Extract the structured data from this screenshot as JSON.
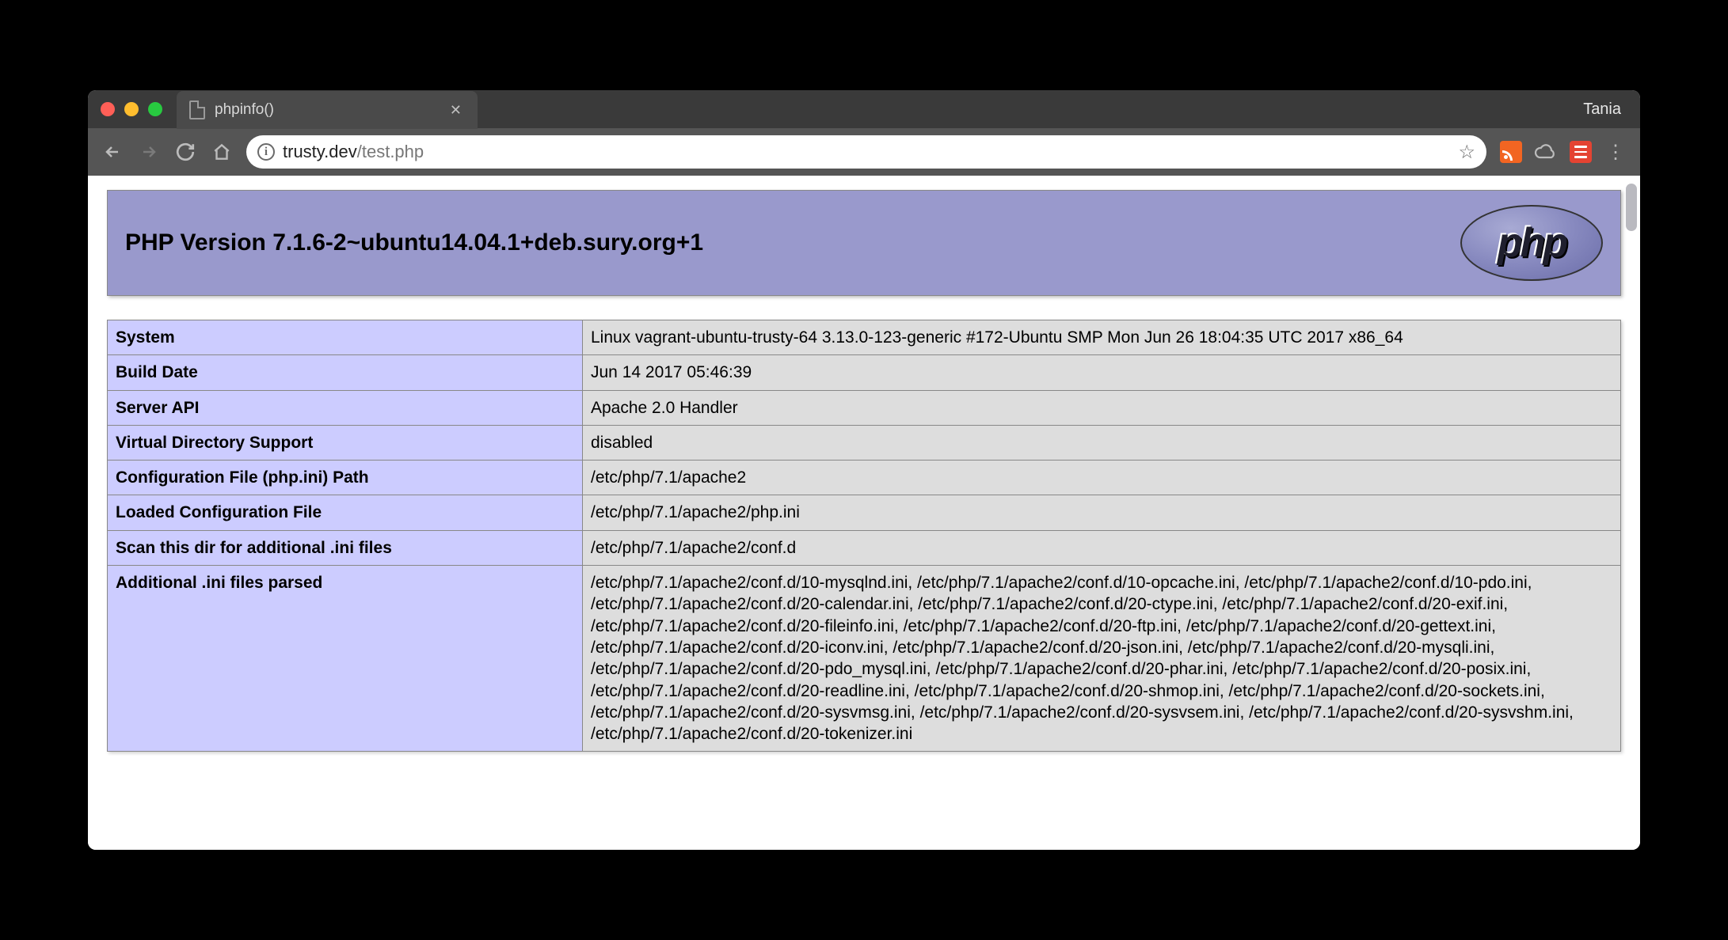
{
  "window": {
    "tab_title": "phpinfo()",
    "profile_name": "Tania"
  },
  "toolbar": {
    "url_host": "trusty.dev",
    "url_path": "/test.php"
  },
  "phpinfo": {
    "heading": "PHP Version 7.1.6-2~ubuntu14.04.1+deb.sury.org+1",
    "logo_text": "php",
    "rows": [
      {
        "k": "System",
        "v": "Linux vagrant-ubuntu-trusty-64 3.13.0-123-generic #172-Ubuntu SMP Mon Jun 26 18:04:35 UTC 2017 x86_64"
      },
      {
        "k": "Build Date",
        "v": "Jun 14 2017 05:46:39"
      },
      {
        "k": "Server API",
        "v": "Apache 2.0 Handler"
      },
      {
        "k": "Virtual Directory Support",
        "v": "disabled"
      },
      {
        "k": "Configuration File (php.ini) Path",
        "v": "/etc/php/7.1/apache2"
      },
      {
        "k": "Loaded Configuration File",
        "v": "/etc/php/7.1/apache2/php.ini"
      },
      {
        "k": "Scan this dir for additional .ini files",
        "v": "/etc/php/7.1/apache2/conf.d"
      },
      {
        "k": "Additional .ini files parsed",
        "v": "/etc/php/7.1/apache2/conf.d/10-mysqlnd.ini, /etc/php/7.1/apache2/conf.d/10-opcache.ini, /etc/php/7.1/apache2/conf.d/10-pdo.ini, /etc/php/7.1/apache2/conf.d/20-calendar.ini, /etc/php/7.1/apache2/conf.d/20-ctype.ini, /etc/php/7.1/apache2/conf.d/20-exif.ini, /etc/php/7.1/apache2/conf.d/20-fileinfo.ini, /etc/php/7.1/apache2/conf.d/20-ftp.ini, /etc/php/7.1/apache2/conf.d/20-gettext.ini, /etc/php/7.1/apache2/conf.d/20-iconv.ini, /etc/php/7.1/apache2/conf.d/20-json.ini, /etc/php/7.1/apache2/conf.d/20-mysqli.ini, /etc/php/7.1/apache2/conf.d/20-pdo_mysql.ini, /etc/php/7.1/apache2/conf.d/20-phar.ini, /etc/php/7.1/apache2/conf.d/20-posix.ini, /etc/php/7.1/apache2/conf.d/20-readline.ini, /etc/php/7.1/apache2/conf.d/20-shmop.ini, /etc/php/7.1/apache2/conf.d/20-sockets.ini, /etc/php/7.1/apache2/conf.d/20-sysvmsg.ini, /etc/php/7.1/apache2/conf.d/20-sysvsem.ini, /etc/php/7.1/apache2/conf.d/20-sysvshm.ini, /etc/php/7.1/apache2/conf.d/20-tokenizer.ini"
      }
    ]
  }
}
